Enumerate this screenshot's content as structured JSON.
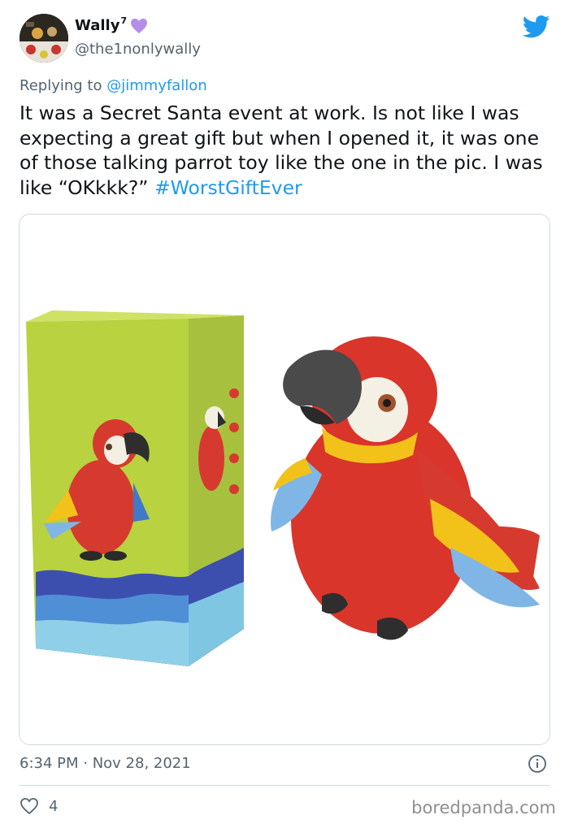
{
  "tweet": {
    "display_name": "Wally",
    "name_superscript": "7",
    "handle": "@the1nonlywally",
    "reply_prefix": "Replying to",
    "reply_to": "@jimmyfallon",
    "body": "It was a Secret Santa event at work. Is not like I was expecting a great gift but when I opened it, it was one of those talking parrot toy like the one in the pic. I was like “OKkkk?”",
    "hashtag": "#WorstGiftEver",
    "timestamp": "6:34 PM · Nov 28, 2021",
    "like_count": "4"
  },
  "watermark": "boredpanda.com",
  "icons": {
    "heart_badge": "purple-heart-icon",
    "platform": "twitter-bird-icon",
    "info": "info-icon",
    "like": "heart-outline-icon"
  },
  "colors": {
    "link": "#1d9bf0",
    "secondary_text": "#536471",
    "heart_badge": "#b48ee8"
  }
}
